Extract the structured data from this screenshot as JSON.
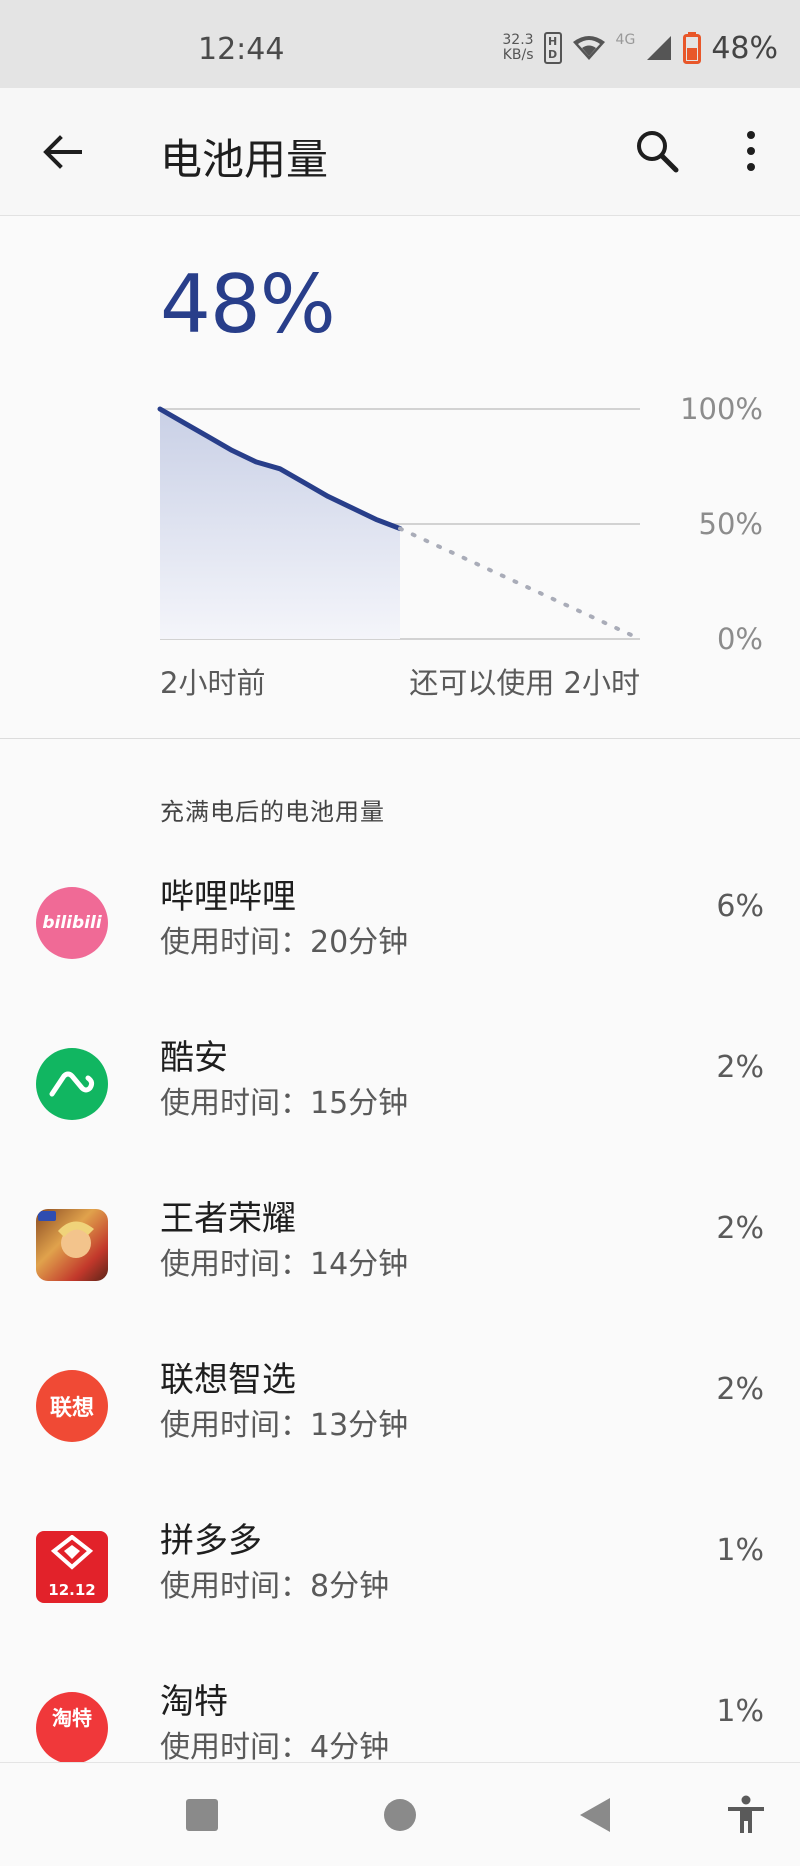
{
  "status_bar": {
    "time": "12:44",
    "net_speed_value": "32.3",
    "net_speed_unit": "KB/s",
    "hd_label_top": "H",
    "hd_label_bottom": "D",
    "network_type": "4G",
    "battery_percent": "48%",
    "battery_icon_color": "#e8572a"
  },
  "toolbar": {
    "title": "电池用量",
    "back_icon": "arrow-back-icon",
    "search_icon": "search-icon",
    "more_icon": "more-vert-icon"
  },
  "battery": {
    "level": "48%",
    "accent_color": "#283e8a"
  },
  "chart_data": {
    "type": "area",
    "series": [
      {
        "x": [
          0,
          0.1,
          0.2,
          0.3,
          0.4,
          0.5,
          0.6,
          0.7,
          0.8,
          0.9,
          1.0
        ],
        "values": [
          100,
          94,
          88,
          82,
          77,
          74,
          68,
          62,
          57,
          52,
          48
        ]
      }
    ],
    "projection": {
      "from": [
        1.0,
        48
      ],
      "to": [
        2.0,
        0
      ]
    },
    "yticks": [
      "100%",
      "50%",
      "0%"
    ],
    "ylim": [
      0,
      100
    ],
    "xlabel_left": "2小时前",
    "xlabel_right": "还可以使用 2小时",
    "grid": true
  },
  "section_header": "充满电后的电池用量",
  "apps": [
    {
      "name": "哔哩哔哩",
      "usage": "使用时间：20分钟",
      "percent": "6%",
      "icon": "bilibili-icon",
      "icon_text": "bilibili",
      "icon_color": "#f06a96"
    },
    {
      "name": "酷安",
      "usage": "使用时间：15分钟",
      "percent": "2%",
      "icon": "coolapk-icon",
      "icon_text": "",
      "icon_color": "#11b661"
    },
    {
      "name": "王者荣耀",
      "usage": "使用时间：14分钟",
      "percent": "2%",
      "icon": "honor-of-kings-icon",
      "icon_text": "",
      "icon_color": "#b8762e"
    },
    {
      "name": "联想智选",
      "usage": "使用时间：13分钟",
      "percent": "2%",
      "icon": "lenovo-icon",
      "icon_text": "联想",
      "icon_color": "#f04a35"
    },
    {
      "name": "拼多多",
      "usage": "使用时间：8分钟",
      "percent": "1%",
      "icon": "pinduoduo-icon",
      "icon_text": "12.12",
      "icon_color": "#e2222a"
    },
    {
      "name": "淘特",
      "usage": "使用时间：4分钟",
      "percent": "1%",
      "icon": "taote-icon",
      "icon_text": "淘特",
      "icon_color": "#f0383a"
    }
  ],
  "nav_bar": {
    "recents_icon": "square-recents-icon",
    "home_icon": "circle-home-icon",
    "back_icon": "triangle-back-icon",
    "accessibility_icon": "accessibility-icon"
  }
}
